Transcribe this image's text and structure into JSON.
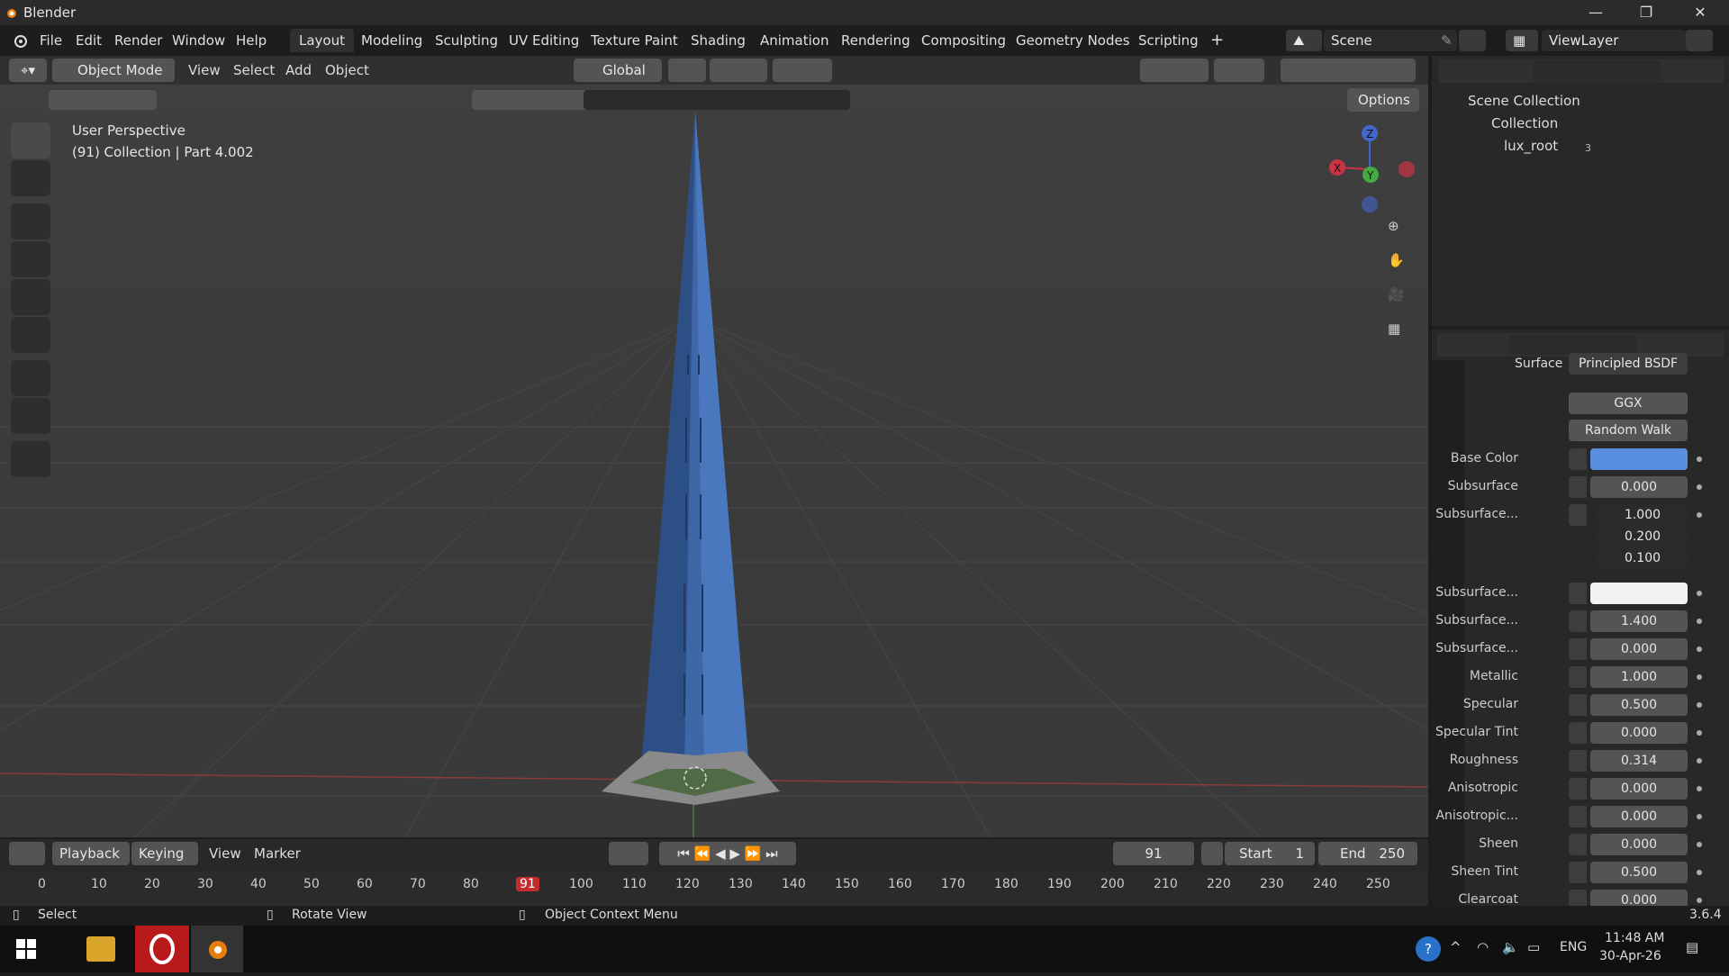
{
  "app": {
    "title": "Blender",
    "version": "3.6.4"
  },
  "menus": [
    "File",
    "Edit",
    "Render",
    "Window",
    "Help"
  ],
  "workspaces": [
    "Layout",
    "Modeling",
    "Sculpting",
    "UV Editing",
    "Texture Paint",
    "Shading",
    "Animation",
    "Rendering",
    "Compositing",
    "Geometry Nodes",
    "Scripting"
  ],
  "active_workspace": "Layout",
  "scene": "Scene",
  "view_layer": "ViewLayer",
  "viewport_header": {
    "mode": "Object Mode",
    "menus": [
      "View",
      "Select",
      "Add",
      "Object"
    ],
    "transform": "Global",
    "options": "Options"
  },
  "viewport": {
    "perspective": "User Perspective",
    "info": "(91) Collection | Part 4.002",
    "axes": {
      "x": "X",
      "y": "Y",
      "z": "Z"
    }
  },
  "outliner": {
    "items": [
      "Scene Collection",
      "Collection",
      "lux_root"
    ],
    "badge": "3"
  },
  "properties": {
    "surface_label": "Surface",
    "surface_value": "Principled BSDF",
    "distribution": "GGX",
    "subsurface_method": "Random Walk",
    "rows": [
      {
        "label": "Base Color",
        "value": "",
        "kind": "color"
      },
      {
        "label": "Subsurface",
        "value": "0.000"
      },
      {
        "label": "Subsurface...",
        "value": "1.000",
        "extra": [
          "0.200",
          "0.100"
        ],
        "kind": "vector"
      },
      {
        "label": "Subsurface...",
        "value": "",
        "kind": "white"
      },
      {
        "label": "Subsurface...",
        "value": "1.400"
      },
      {
        "label": "Subsurface...",
        "value": "0.000"
      },
      {
        "label": "Metallic",
        "value": "1.000"
      },
      {
        "label": "Specular",
        "value": "0.500"
      },
      {
        "label": "Specular Tint",
        "value": "0.000"
      },
      {
        "label": "Roughness",
        "value": "0.314"
      },
      {
        "label": "Anisotropic",
        "value": "0.000"
      },
      {
        "label": "Anisotropic...",
        "value": "0.000"
      },
      {
        "label": "Sheen",
        "value": "0.000"
      },
      {
        "label": "Sheen Tint",
        "value": "0.500"
      },
      {
        "label": "Clearcoat",
        "value": "0.000"
      }
    ]
  },
  "timeline": {
    "menus": [
      "Playback",
      "Keying",
      "View",
      "Marker"
    ],
    "current_frame": "91",
    "start_label": "Start",
    "start": "1",
    "end_label": "End",
    "end": "250",
    "ticks": [
      "0",
      "10",
      "20",
      "30",
      "40",
      "50",
      "60",
      "70",
      "80",
      "91",
      "100",
      "110",
      "120",
      "130",
      "140",
      "150",
      "160",
      "170",
      "180",
      "190",
      "200",
      "210",
      "220",
      "230",
      "240",
      "250"
    ]
  },
  "statusbar": {
    "select": "Select",
    "rotate": "Rotate View",
    "context": "Object Context Menu"
  },
  "taskbar": {
    "lang": "ENG",
    "time": "11:48 AM",
    "date": "30-Apr-26"
  },
  "colors": {
    "accent": "#4772b3",
    "base_color": "#5a8fe0",
    "frame_marker": "#c42d2d"
  }
}
